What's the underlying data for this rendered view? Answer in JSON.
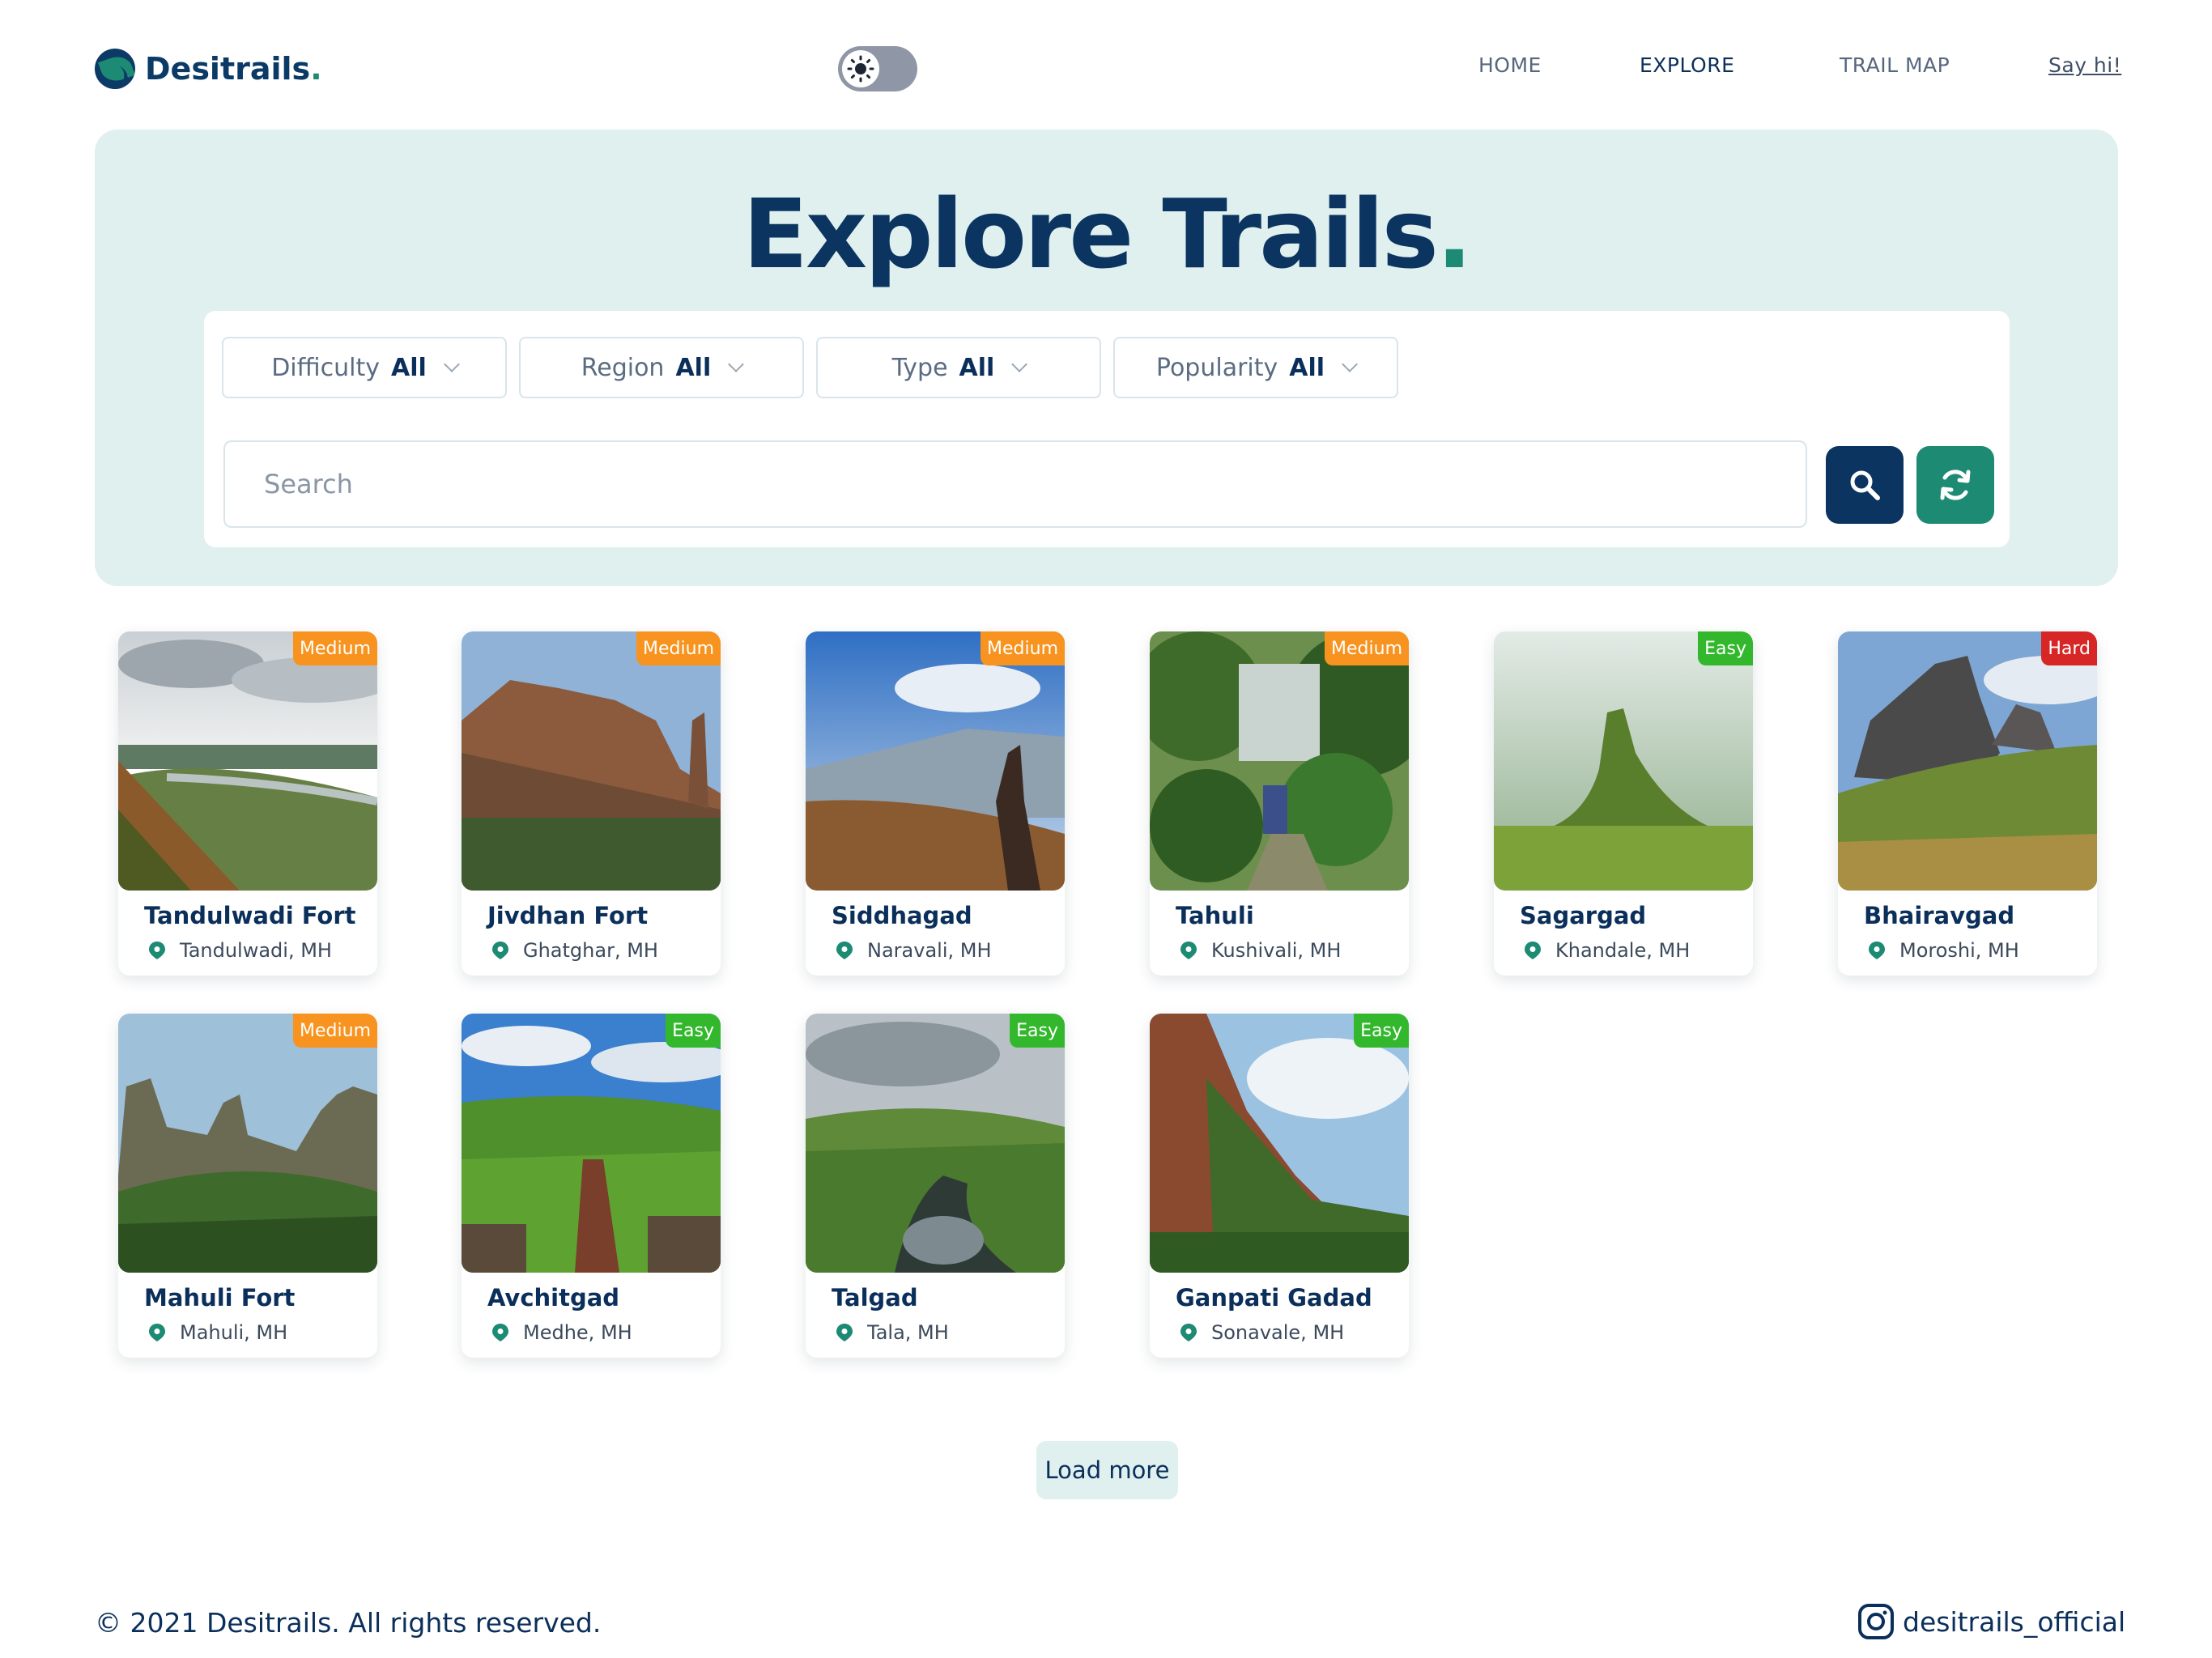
{
  "header": {
    "logo_text": "Desitrails",
    "logo_dot": ".",
    "nav": [
      {
        "label": "HOME"
      },
      {
        "label": "EXPLORE"
      },
      {
        "label": "TRAIL MAP"
      },
      {
        "label": "Say hi!"
      }
    ],
    "theme_toggle": {
      "icon": "sun-icon",
      "state": "light"
    }
  },
  "hero": {
    "title": "Explore Trails",
    "title_dot": ".",
    "filters": [
      {
        "label": "Difficulty",
        "value": "All"
      },
      {
        "label": "Region",
        "value": "All"
      },
      {
        "label": "Type",
        "value": "All"
      },
      {
        "label": "Popularity",
        "value": "All"
      }
    ],
    "search": {
      "placeholder": "Search",
      "value": ""
    },
    "search_button_icon": "search-icon",
    "reset_button_icon": "refresh-icon"
  },
  "trails": [
    {
      "name": "Tandulwadi Fort",
      "location": "Tandulwadi, MH",
      "difficulty": "Medium"
    },
    {
      "name": "Jivdhan Fort",
      "location": "Ghatghar, MH",
      "difficulty": "Medium"
    },
    {
      "name": "Siddhagad",
      "location": "Naravali, MH",
      "difficulty": "Medium"
    },
    {
      "name": "Tahuli",
      "location": "Kushivali, MH",
      "difficulty": "Medium"
    },
    {
      "name": "Sagargad",
      "location": "Khandale, MH",
      "difficulty": "Easy"
    },
    {
      "name": "Bhairavgad",
      "location": "Moroshi, MH",
      "difficulty": "Hard"
    },
    {
      "name": "Mahuli Fort",
      "location": "Mahuli, MH",
      "difficulty": "Medium"
    },
    {
      "name": "Avchitgad",
      "location": "Medhe, MH",
      "difficulty": "Easy"
    },
    {
      "name": "Talgad",
      "location": "Tala, MH",
      "difficulty": "Easy"
    },
    {
      "name": "Ganpati Gadad",
      "location": "Sonavale, MH",
      "difficulty": "Easy"
    }
  ],
  "load_more_label": "Load more",
  "footer": {
    "copyright": "© 2021 Desitrails. All rights reserved.",
    "instagram_handle": "desitrails_official",
    "instagram_icon": "instagram-icon"
  },
  "colors": {
    "brand_navy": "#0b3560",
    "brand_teal": "#1d8a74",
    "hero_bg": "#dff0ef",
    "badge_medium": "#f7931e",
    "badge_easy": "#33b82d",
    "badge_hard": "#d72626"
  }
}
